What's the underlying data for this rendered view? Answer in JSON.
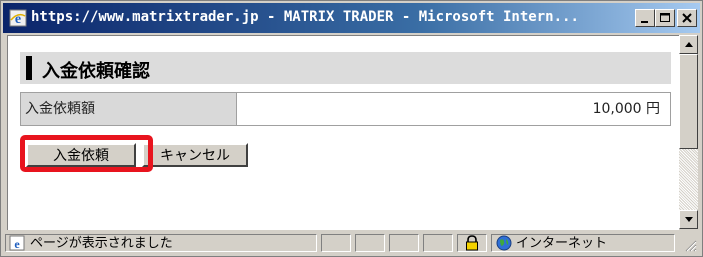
{
  "window": {
    "title": "https://www.matrixtrader.jp - MATRIX TRADER - Microsoft Intern..."
  },
  "panel": {
    "title": "入金依頼確認",
    "rows": [
      {
        "label": "入金依頼額",
        "value": "10,000 円"
      }
    ]
  },
  "buttons": {
    "submit_label": "入金依頼",
    "cancel_label": "キャンセル"
  },
  "statusbar": {
    "status_text": "ページが表示されました",
    "zone_text": "インターネット"
  },
  "colors": {
    "highlight": "#e8141e",
    "titlebar_start": "#0a246a",
    "titlebar_end": "#a6caf0"
  },
  "icons": {
    "title_icon": "ie-icon",
    "status_page_icon": "ie-page-icon",
    "lock": "lock-icon",
    "zone": "globe-icon"
  }
}
